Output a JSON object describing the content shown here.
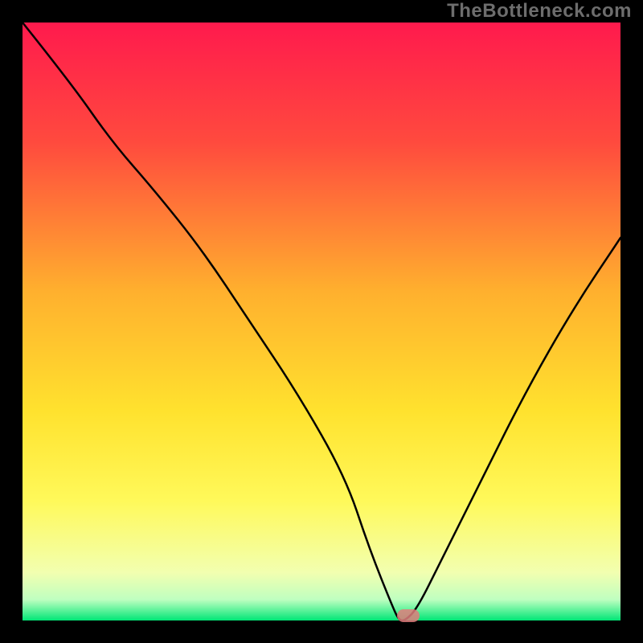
{
  "watermark": "TheBottleneck.com",
  "chart_data": {
    "type": "line",
    "title": "",
    "xlabel": "",
    "ylabel": "",
    "xlim": [
      0,
      100
    ],
    "ylim": [
      0,
      100
    ],
    "grid": false,
    "legend": false,
    "background_gradient_stops": [
      {
        "offset": 0.0,
        "color": "#ff1a4d"
      },
      {
        "offset": 0.2,
        "color": "#ff4a3e"
      },
      {
        "offset": 0.45,
        "color": "#ffb02e"
      },
      {
        "offset": 0.65,
        "color": "#ffe22e"
      },
      {
        "offset": 0.8,
        "color": "#fff95a"
      },
      {
        "offset": 0.92,
        "color": "#f2ffb0"
      },
      {
        "offset": 0.965,
        "color": "#bfffc0"
      },
      {
        "offset": 1.0,
        "color": "#00e676"
      }
    ],
    "series": [
      {
        "name": "bottleneck-curve",
        "x": [
          0,
          8,
          15,
          22,
          30,
          38,
          46,
          54,
          58,
          62,
          63,
          64,
          66,
          70,
          76,
          84,
          92,
          100
        ],
        "y": [
          100,
          90,
          80,
          72,
          62,
          50,
          38,
          24,
          12,
          2,
          0,
          0,
          2,
          10,
          22,
          38,
          52,
          64
        ]
      }
    ],
    "marker": {
      "x": 64.5,
      "y": 0.8,
      "color": "#e07c7c"
    }
  }
}
